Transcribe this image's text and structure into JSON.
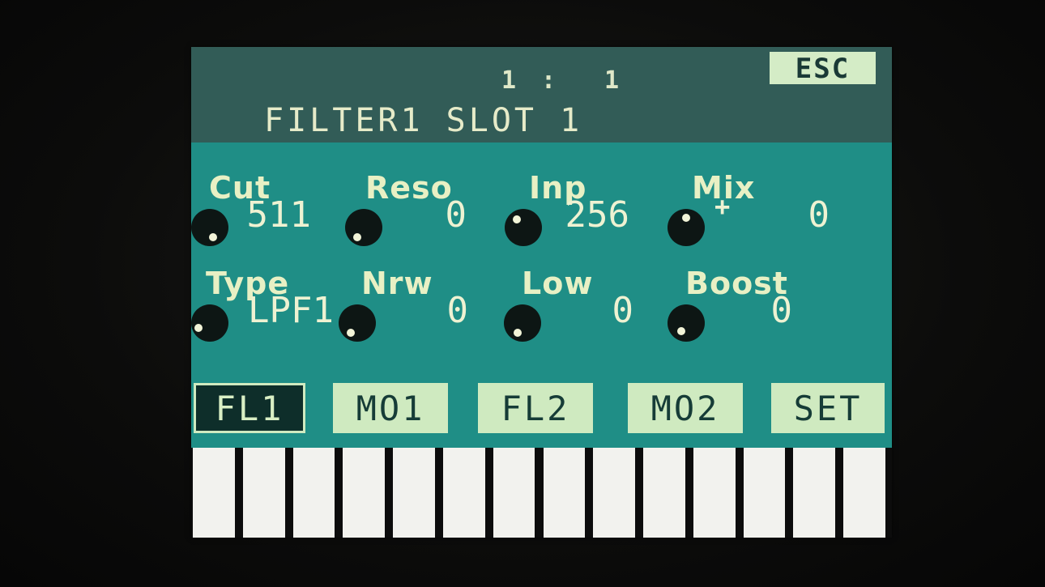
{
  "header": {
    "counter_left": "1",
    "counter_sep": ":",
    "counter_right": "1",
    "title": "FILTER1 SLOT 1",
    "esc_label": "ESC"
  },
  "params": {
    "row1": [
      {
        "label": "Cut",
        "value": "511"
      },
      {
        "label": "Reso",
        "value": "0"
      },
      {
        "label": "Inp",
        "value": "256"
      },
      {
        "label": "Mix",
        "value": "0",
        "sign": "+"
      }
    ],
    "row2": [
      {
        "label": "Type",
        "value": "LPF1"
      },
      {
        "label": "Nrw",
        "value": "0"
      },
      {
        "label": "Low",
        "value": "0"
      },
      {
        "label": "Boost",
        "value": "0"
      }
    ]
  },
  "tabs": [
    {
      "label": "FL1",
      "active": true
    },
    {
      "label": "MO1",
      "active": false
    },
    {
      "label": "FL2",
      "active": false
    },
    {
      "label": "MO2",
      "active": false
    },
    {
      "label": "SET",
      "active": false
    }
  ],
  "colors": {
    "screen_bg": "#1f8e86",
    "header_bg": "#325c57",
    "button_bg": "#cfeac0",
    "active_tab_bg": "#0e2e2a",
    "text": "#e8f0c4"
  },
  "keyboard": {
    "white_keys": 14
  }
}
